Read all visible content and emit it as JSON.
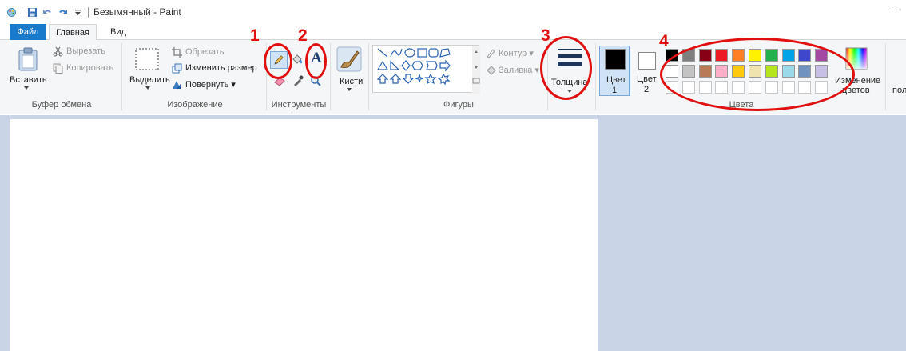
{
  "titlebar": {
    "title": "Безымянный - Paint",
    "minimize_label": "–"
  },
  "tabs": [
    {
      "label": "Файл"
    },
    {
      "label": "Главная"
    },
    {
      "label": "Вид"
    }
  ],
  "clipboard": {
    "paste_label": "Вставить",
    "cut_label": "Вырезать",
    "copy_label": "Копировать",
    "group_label": "Буфер обмена"
  },
  "image": {
    "select_label": "Выделить",
    "crop_label": "Обрезать",
    "resize_label": "Изменить размер",
    "rotate_label": "Повернуть",
    "group_label": "Изображение"
  },
  "tools": {
    "group_label": "Инструменты",
    "text_glyph": "A"
  },
  "brushes": {
    "label": "Кисти"
  },
  "shapes": {
    "group_label": "Фигуры",
    "outline_label": "Контур",
    "fill_label": "Заливка"
  },
  "thickness": {
    "label": "Толщина"
  },
  "colors": {
    "color1_label": "Цвет",
    "color1_num": "1",
    "color2_label": "Цвет",
    "color2_num": "2",
    "group_label": "Цвета",
    "edit_line1": "Изменение",
    "edit_line2": "цветов",
    "cut_text": "пол",
    "color1_value": "#000000",
    "color2_value": "#ffffff",
    "palette_row1": [
      "#000000",
      "#7f7f7f",
      "#880015",
      "#ed1c24",
      "#ff7f27",
      "#fff200",
      "#22b14c",
      "#00a2e8",
      "#3f48cc",
      "#a349a4"
    ],
    "palette_row2": [
      "#ffffff",
      "#c3c3c3",
      "#b97a57",
      "#ffaec9",
      "#ffc90e",
      "#efe4b0",
      "#b5e61d",
      "#99d9ea",
      "#7092be",
      "#c8bfe7"
    ]
  },
  "annotations": [
    {
      "num": "1"
    },
    {
      "num": "2"
    },
    {
      "num": "3"
    },
    {
      "num": "4"
    }
  ]
}
